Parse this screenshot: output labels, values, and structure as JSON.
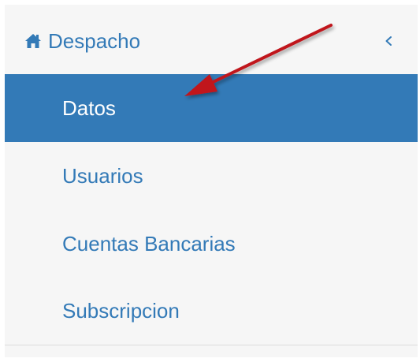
{
  "menu": {
    "title": "Despacho",
    "title_icon": "home-icon",
    "collapse_icon": "chevron-left-icon",
    "items": [
      {
        "label": "Datos",
        "active": true
      },
      {
        "label": "Usuarios",
        "active": false
      },
      {
        "label": "Cuentas Bancarias",
        "active": false
      },
      {
        "label": "Subscripcion",
        "active": false
      }
    ]
  },
  "colors": {
    "accent": "#337ab7",
    "background": "#f6f6f6",
    "active_text": "#ffffff",
    "annotation_arrow": "#c0141c"
  },
  "annotation": {
    "type": "arrow",
    "points_to": "Datos"
  }
}
